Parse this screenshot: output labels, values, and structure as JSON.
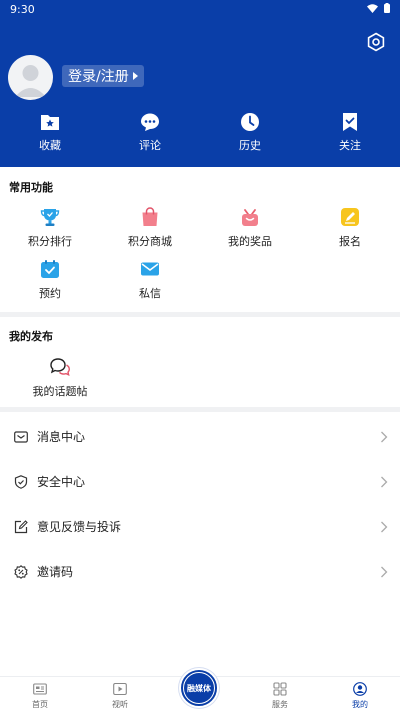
{
  "status_bar": {
    "time": "9:30"
  },
  "header": {
    "login_label": "登录/注册",
    "quick_actions": [
      {
        "label": "收藏",
        "icon": "favorite-folder-icon"
      },
      {
        "label": "评论",
        "icon": "comment-icon"
      },
      {
        "label": "历史",
        "icon": "history-clock-icon"
      },
      {
        "label": "关注",
        "icon": "follow-bookmark-icon"
      }
    ]
  },
  "common_functions": {
    "title": "常用功能",
    "items": [
      {
        "label": "积分排行",
        "icon": "trophy-icon"
      },
      {
        "label": "积分商城",
        "icon": "shopping-bag-icon"
      },
      {
        "label": "我的奖品",
        "icon": "gift-icon"
      },
      {
        "label": "报名",
        "icon": "edit-pen-icon"
      },
      {
        "label": "预约",
        "icon": "calendar-check-icon"
      },
      {
        "label": "私信",
        "icon": "mail-icon"
      }
    ]
  },
  "my_posts": {
    "title": "我的发布",
    "items": [
      {
        "label": "我的话题帖",
        "icon": "chat-bubbles-icon"
      }
    ]
  },
  "menu_list": [
    {
      "label": "消息中心",
      "icon": "message-icon"
    },
    {
      "label": "安全中心",
      "icon": "shield-icon"
    },
    {
      "label": "意见反馈与投诉",
      "icon": "feedback-icon"
    },
    {
      "label": "邀请码",
      "icon": "invite-code-icon"
    }
  ],
  "tabbar": {
    "tabs": [
      {
        "label": "首页",
        "icon": "home-news-icon"
      },
      {
        "label": "视听",
        "icon": "video-play-icon"
      },
      {
        "label": "服务",
        "icon": "grid-service-icon"
      },
      {
        "label": "我的",
        "icon": "user-profile-icon"
      }
    ],
    "center_label": "融媒体"
  },
  "colors": {
    "primary": "#0a3ea8",
    "divider": "#f0f1f3"
  }
}
